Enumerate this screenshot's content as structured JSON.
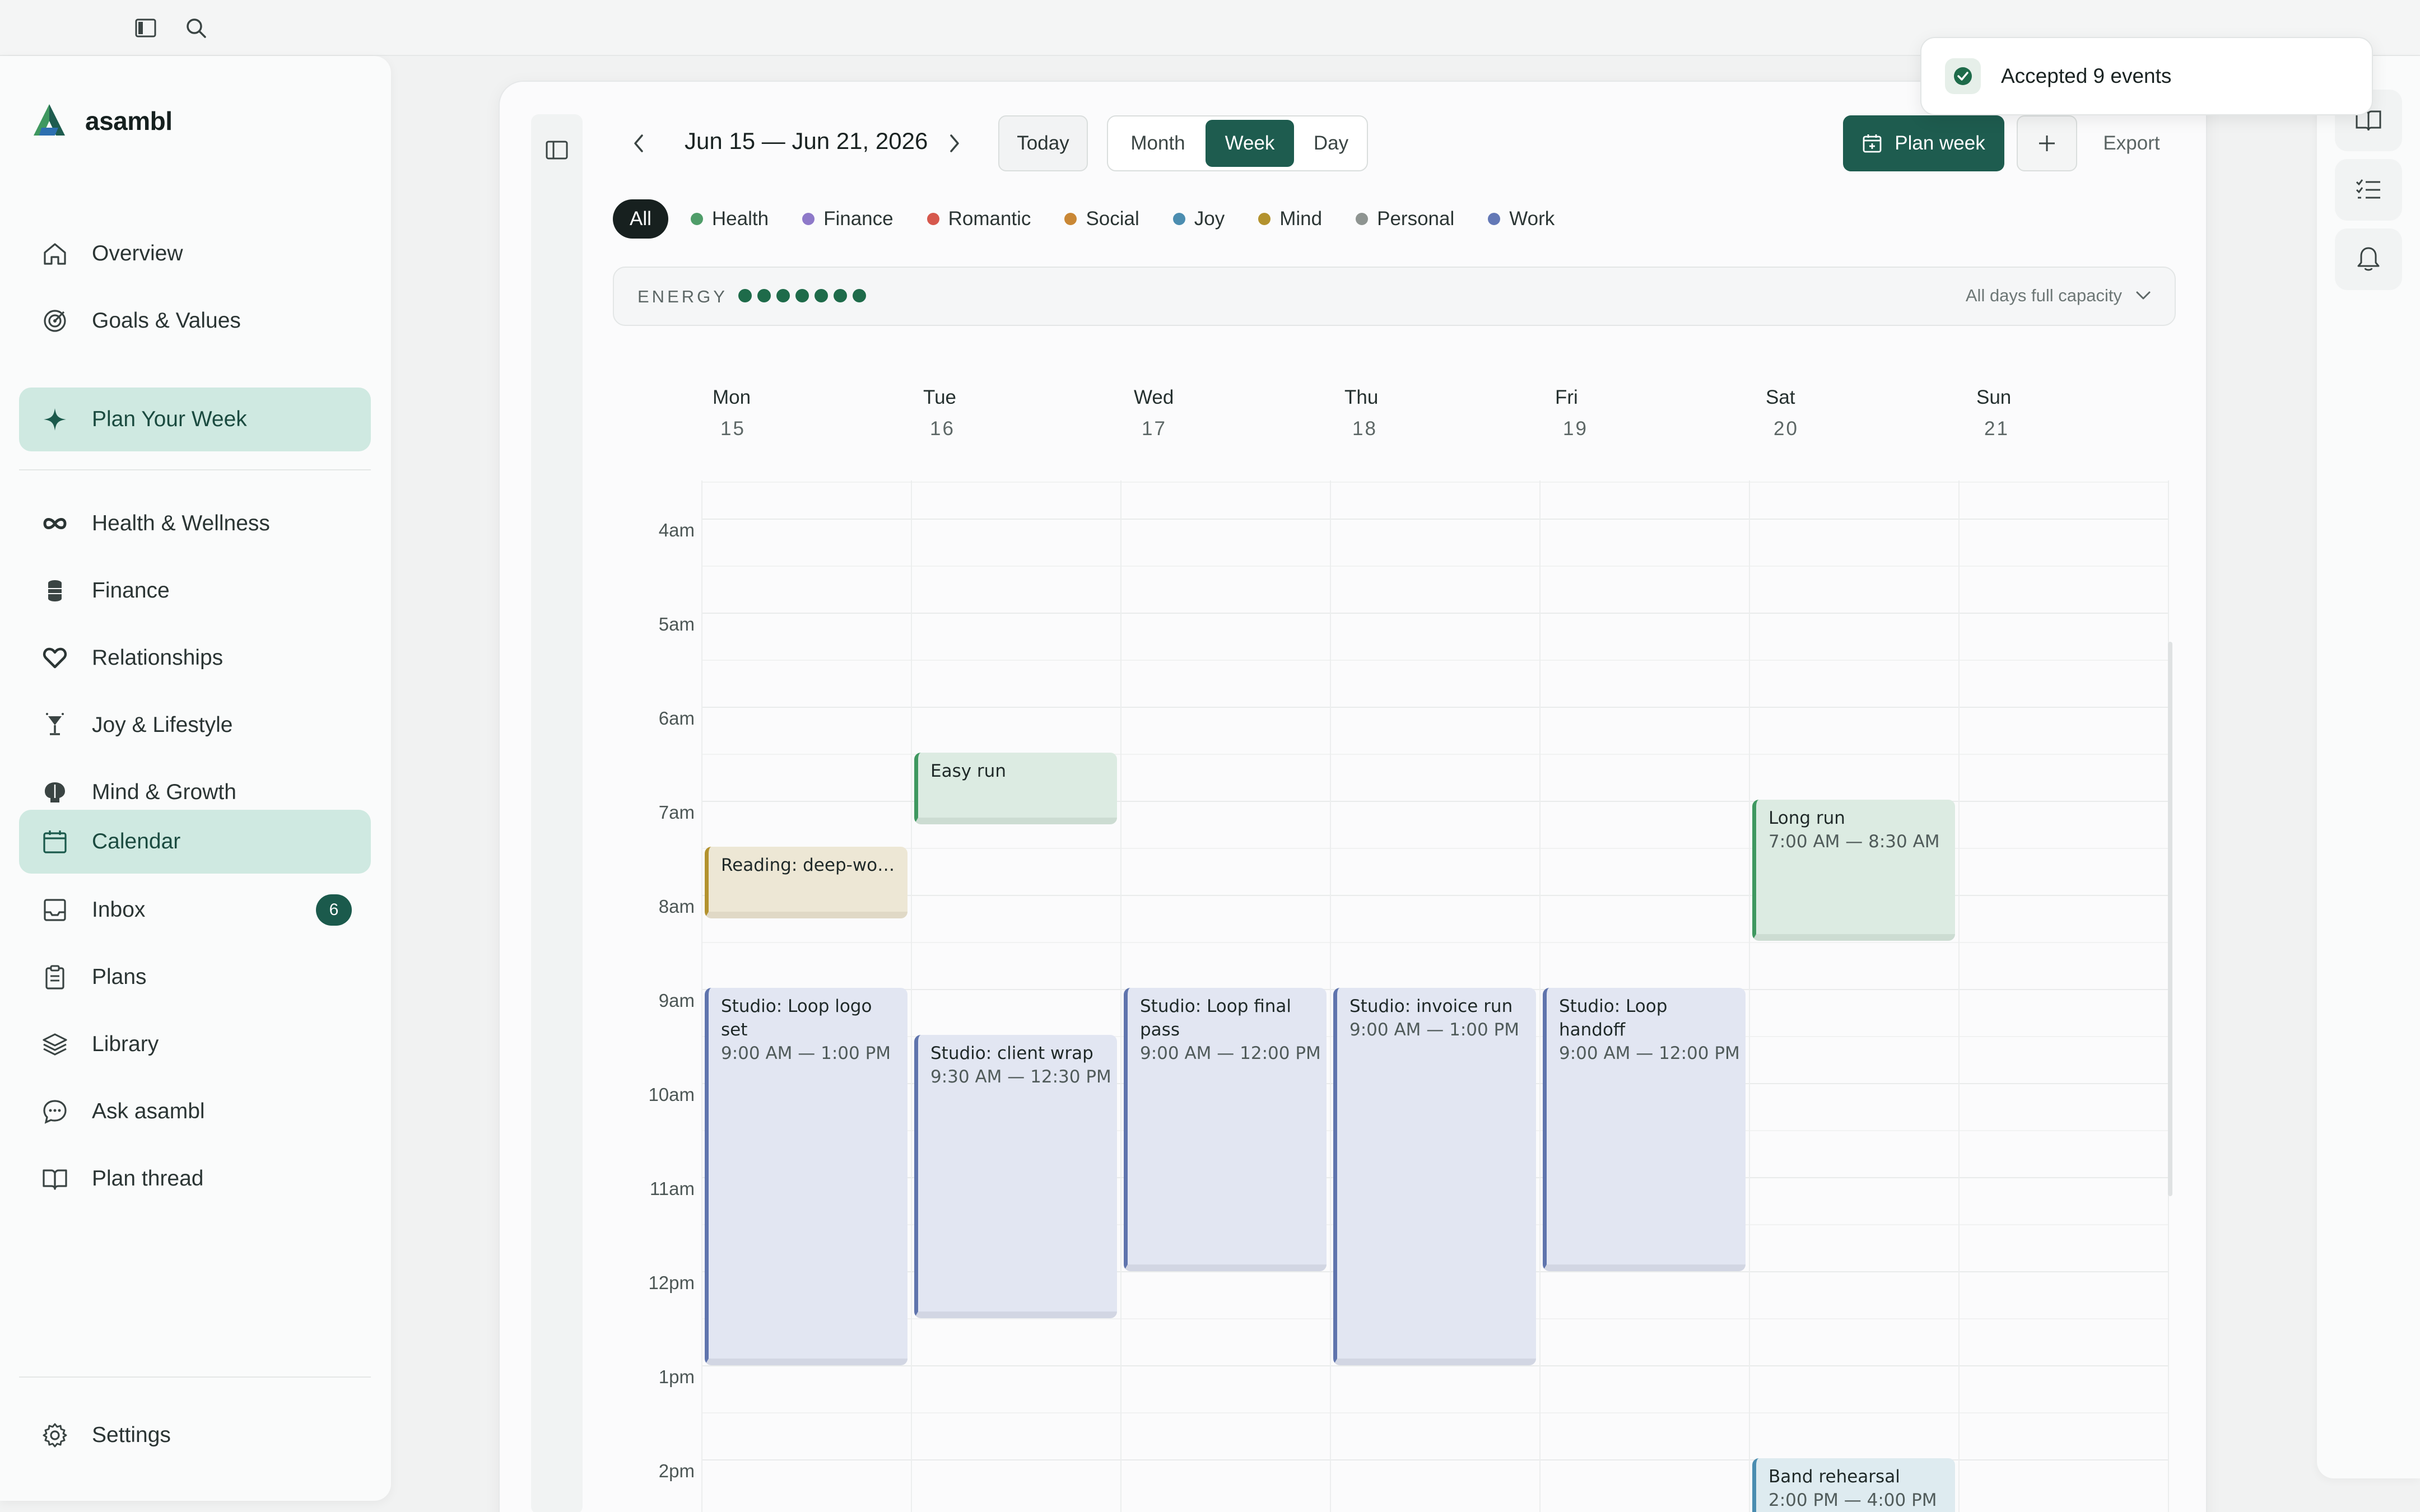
{
  "app": {
    "name": "asambl"
  },
  "sidebar": {
    "items": [
      {
        "label": "Overview",
        "icon": "home-icon"
      },
      {
        "label": "Goals & Values",
        "icon": "target-icon"
      },
      {
        "label": "Plan Your Week",
        "icon": "sparkle-icon",
        "active": true
      },
      {
        "label": "Health & Wellness",
        "icon": "infinity-icon"
      },
      {
        "label": "Finance",
        "icon": "coins-icon"
      },
      {
        "label": "Relationships",
        "icon": "heart-icon"
      },
      {
        "label": "Joy & Lifestyle",
        "icon": "cocktail-icon"
      },
      {
        "label": "Mind & Growth",
        "icon": "brain-icon"
      },
      {
        "label": "Calendar",
        "icon": "calendar-icon",
        "active": true
      },
      {
        "label": "Inbox",
        "icon": "inbox-icon",
        "badge": "6"
      },
      {
        "label": "Plans",
        "icon": "clipboard-icon"
      },
      {
        "label": "Library",
        "icon": "layers-icon"
      },
      {
        "label": "Ask asambl",
        "icon": "chat-icon"
      },
      {
        "label": "Plan thread",
        "icon": "book-icon"
      }
    ],
    "settings": {
      "label": "Settings",
      "icon": "gear-icon"
    }
  },
  "toolbar": {
    "date_range": "Jun 15 — Jun 21, 2026",
    "today": "Today",
    "views": [
      "Month",
      "Week",
      "Day"
    ],
    "active_view": "Week",
    "plan_week": "Plan week",
    "export": "Export"
  },
  "filters": [
    {
      "label": "All",
      "active": true
    },
    {
      "label": "Health",
      "color": "#4f9d69"
    },
    {
      "label": "Finance",
      "color": "#8e79c9"
    },
    {
      "label": "Romantic",
      "color": "#d6584d"
    },
    {
      "label": "Social",
      "color": "#c98735"
    },
    {
      "label": "Joy",
      "color": "#4b8db0"
    },
    {
      "label": "Mind",
      "color": "#b3922e"
    },
    {
      "label": "Personal",
      "color": "#8e9491"
    },
    {
      "label": "Work",
      "color": "#6378b6"
    }
  ],
  "energy": {
    "label": "ENERGY",
    "level": 7,
    "capacity": "All days full capacity"
  },
  "days": [
    {
      "name": "Mon",
      "date": "15"
    },
    {
      "name": "Tue",
      "date": "16"
    },
    {
      "name": "Wed",
      "date": "17"
    },
    {
      "name": "Thu",
      "date": "18"
    },
    {
      "name": "Fri",
      "date": "19"
    },
    {
      "name": "Sat",
      "date": "20"
    },
    {
      "name": "Sun",
      "date": "21"
    }
  ],
  "hours": [
    "4am",
    "5am",
    "6am",
    "7am",
    "8am",
    "9am",
    "10am",
    "11am",
    "12pm",
    "1pm",
    "2pm"
  ],
  "events": [
    {
      "title": "Easy run",
      "time": "",
      "category": "health",
      "day": 1
    },
    {
      "title": "Reading: deep-wo…",
      "time": "",
      "category": "mind",
      "day": 0
    },
    {
      "title": "Long run",
      "time": "7:00 AM — 8:30 AM",
      "category": "health",
      "day": 5
    },
    {
      "title": "Studio: Loop logo set",
      "time": "9:00 AM — 1:00 PM",
      "category": "work",
      "day": 0
    },
    {
      "title": "Studio: client wrap",
      "time": "9:30 AM — 12:30 PM",
      "category": "work",
      "day": 1
    },
    {
      "title": "Studio: Loop final pass",
      "time": "9:00 AM — 12:00 PM",
      "category": "work",
      "day": 2
    },
    {
      "title": "Studio: invoice run",
      "time": "9:00 AM — 1:00 PM",
      "category": "work",
      "day": 3
    },
    {
      "title": "Studio: Loop handoff",
      "time": "9:00 AM — 12:00 PM",
      "category": "work",
      "day": 4
    },
    {
      "title": "Band rehearsal",
      "time": "2:00 PM — 4:00 PM",
      "category": "joy",
      "day": 5
    }
  ],
  "toast": {
    "message": "Accepted 9 events"
  }
}
